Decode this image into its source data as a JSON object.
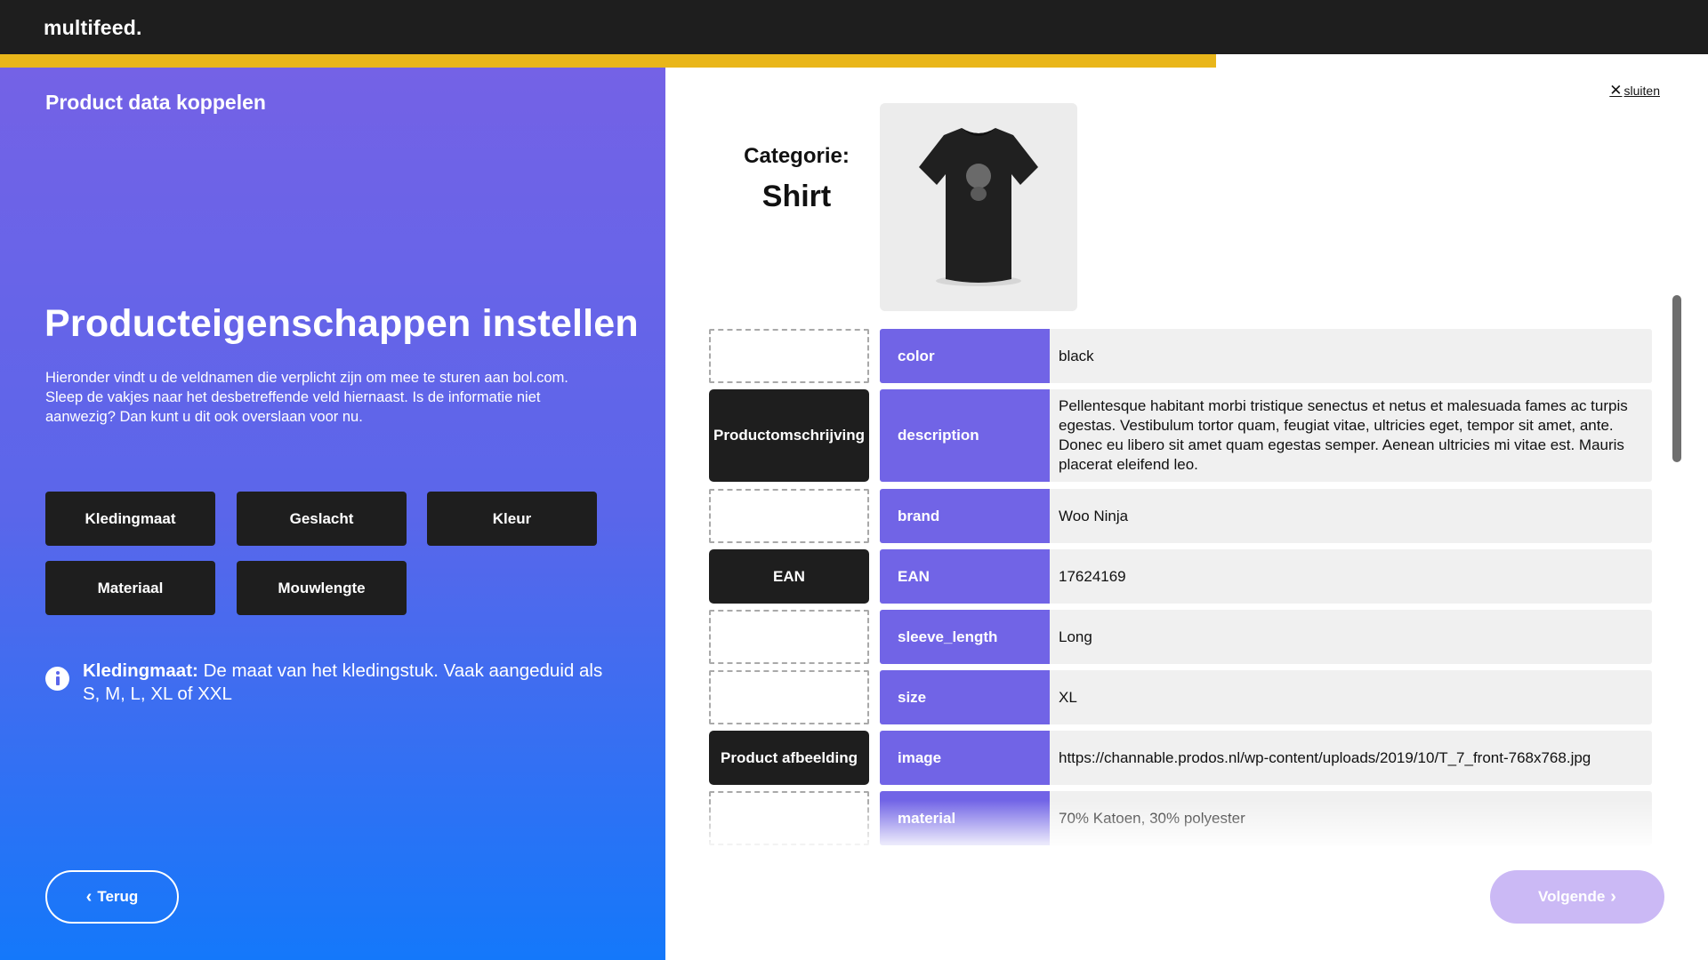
{
  "header": {
    "logo": "multifeed."
  },
  "progress": {
    "fraction": 0.712,
    "color": "#e9b61a"
  },
  "left_panel": {
    "step_title": "Product data koppelen",
    "title": "Producteigenschappen instellen",
    "intro": "Hieronder vindt u de veldnamen die verplicht zijn om mee te sturen aan bol.com. Sleep de vakjes naar het desbetreffende veld hiernaast. Is de informatie niet aanwezig? Dan kunt u dit ook overslaan voor nu.",
    "chips": [
      "Kledingmaat",
      "Geslacht",
      "Kleur",
      "Materiaal",
      "Mouwlengte"
    ],
    "info_label": "Kledingmaat:",
    "info_text": "De maat van het kledingstuk. Vaak aangeduid als S, M, L, XL of XXL",
    "info_icon": "info-icon",
    "back_label": "Terug",
    "gradient": [
      "#7462e6",
      "#1478fa"
    ]
  },
  "right_panel": {
    "close_label": "sluiten",
    "category_label": "Categorie:",
    "category_value": "Shirt",
    "product_image": "black-tshirt",
    "rows": [
      {
        "slot": "",
        "field": "color",
        "value": "black"
      },
      {
        "slot": "Productomschrijving",
        "field": "description",
        "value": "Pellentesque habitant morbi tristique senectus et netus et malesuada fames ac turpis egestas. Vestibulum tortor quam, feugiat vitae, ultricies eget, tempor sit amet, ante. Donec eu libero sit amet quam egestas semper. Aenean ultricies mi vitae est. Mauris placerat eleifend leo."
      },
      {
        "slot": "",
        "field": "brand",
        "value": "Woo Ninja"
      },
      {
        "slot": "EAN",
        "field": "EAN",
        "value": "17624169"
      },
      {
        "slot": "",
        "field": "sleeve_length",
        "value": "Long"
      },
      {
        "slot": "",
        "field": "size",
        "value": "XL"
      },
      {
        "slot": "Product afbeelding",
        "field": "image",
        "value": "https://channable.prodos.nl/wp-content/uploads/2019/10/T_7_front-768x768.jpg"
      },
      {
        "slot": "",
        "field": "material",
        "value": "70% Katoen, 30% polyester"
      }
    ],
    "next_label": "Volgende",
    "accent": "#7164e6"
  }
}
